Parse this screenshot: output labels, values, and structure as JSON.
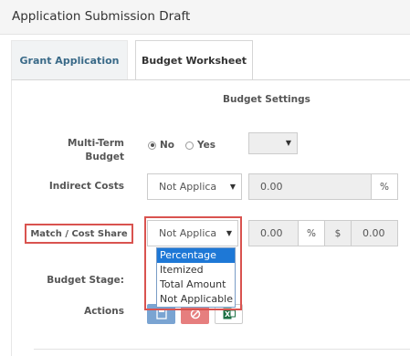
{
  "header": {
    "title": "Application Submission Draft"
  },
  "tabs": [
    {
      "label": "Grant Application",
      "active": false
    },
    {
      "label": "Budget Worksheet",
      "active": true
    }
  ],
  "section_title": "Budget Settings",
  "multi_term": {
    "label_line1": "Multi-Term",
    "label_line2": "Budget",
    "options": [
      "No",
      "Yes"
    ],
    "selected": "No",
    "select_value": ""
  },
  "indirect_costs": {
    "label": "Indirect Costs",
    "select_value": "Not Applica",
    "amount": "0.00",
    "unit": "%"
  },
  "match_cost_share": {
    "label": "Match / Cost Share",
    "select_value": "Not Applica",
    "percent_value": "0.00",
    "percent_unit": "%",
    "currency_unit": "$",
    "dollar_value": "0.00",
    "dropdown_options": [
      "Percentage",
      "Itemized",
      "Total Amount",
      "Not Applicable"
    ],
    "highlighted_option": "Percentage"
  },
  "budget_stage": {
    "label": "Budget Stage:"
  },
  "actions": {
    "label": "Actions",
    "icons": [
      "save-icon",
      "cancel-icon",
      "excel-icon"
    ]
  },
  "colors": {
    "highlight_border": "#d9534f",
    "tab_link": "#3a6a88",
    "dropdown_selected": "#1e78d6"
  }
}
